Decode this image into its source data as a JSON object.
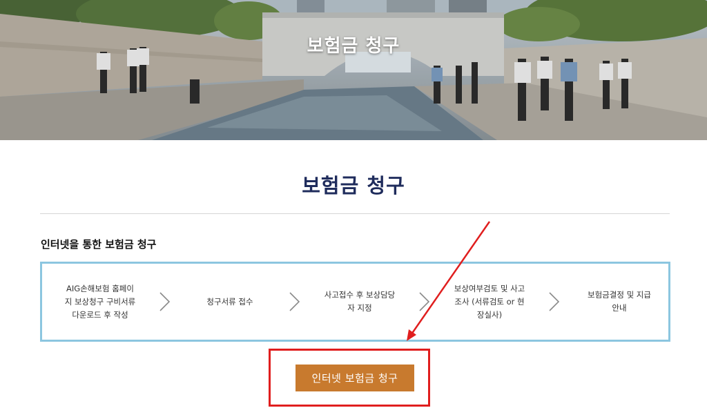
{
  "hero": {
    "title": "보험금 청구",
    "image": "cheonggyecheon-stream-photo"
  },
  "page": {
    "title": "보험금 청구",
    "section_title": "인터넷을 통한 보험금 청구"
  },
  "process": {
    "steps": [
      {
        "lines": [
          "AIG손해보험 홈페이",
          "지 보상청구 구비서류",
          "다운로드 후 작성"
        ]
      },
      {
        "lines": [
          "청구서류 접수"
        ]
      },
      {
        "lines": [
          "사고접수 후 보상담당",
          "자 지정"
        ]
      },
      {
        "lines": [
          "보상여부검토 및 사고",
          "조사 (서류검토 or 현",
          "장실사)"
        ]
      },
      {
        "lines": [
          "보험금결정 및 지급",
          "안내"
        ]
      }
    ],
    "separator_icon": "chevron-right-icon"
  },
  "claim_button": {
    "label": "인터넷 보험금 청구"
  },
  "annotation": {
    "highlight_color": "#e01e1e",
    "arrow_icon": "red-arrow-icon"
  },
  "colors": {
    "heading": "#1f2c5c",
    "process_border": "#8cc6e0",
    "button_bg": "#c87a2e"
  }
}
